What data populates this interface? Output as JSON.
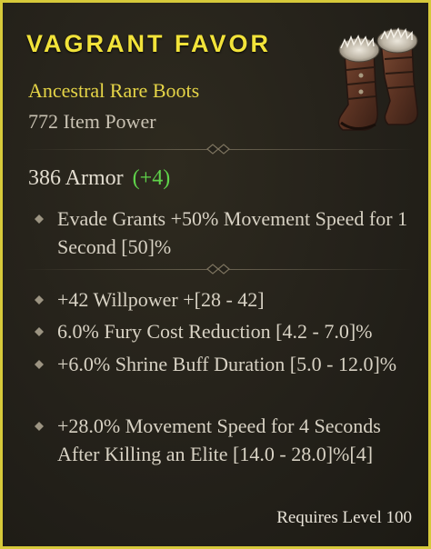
{
  "item": {
    "name": "VAGRANT FAVOR",
    "type": "Ancestral Rare Boots",
    "power": "772 Item Power",
    "image_icon": "boots-icon"
  },
  "armor": {
    "text": "386 Armor",
    "bonus": "(+4)"
  },
  "implicit_affixes": [
    "Evade Grants +50% Movement Speed for 1 Second [50]%"
  ],
  "affixes": [
    "+42 Willpower +[28 - 42]",
    "6.0% Fury Cost Reduction [4.2 - 7.0]%",
    "+6.0% Shrine Buff Duration [5.0 - 12.0]%",
    "+28.0% Movement Speed for 4 Seconds After Killing an Elite [14.0 - 28.0]%[4]"
  ],
  "requirement": "Requires Level 100",
  "colors": {
    "border": "#d6c93a",
    "name": "#f2e33a",
    "type": "#e6d547",
    "bonus": "#5fd34a",
    "text": "#d8d2c4"
  }
}
